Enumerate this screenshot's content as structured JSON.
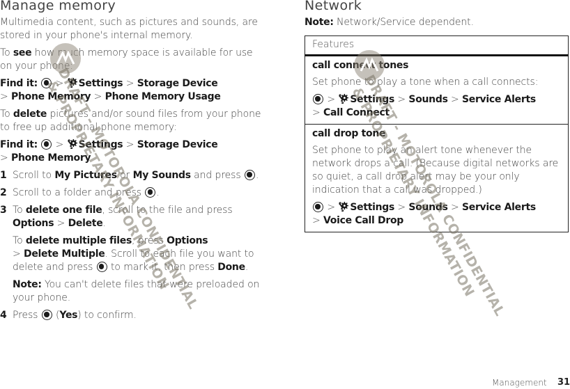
{
  "left": {
    "title": "Manage memory",
    "intro": "Multimedia content, such as pictures and sounds, are stored in your phone's internal memory.",
    "see_para": {
      "pre": "To ",
      "bold": "see",
      "post": " how much memory space is available for use on your phone:"
    },
    "find_it_1": {
      "label": "Find it:",
      "path": [
        "Settings",
        "Storage Device",
        "Phone Memory",
        "Phone Memory Usage"
      ]
    },
    "delete_para": {
      "pre": "To ",
      "bold": "delete",
      "post": " pictures and/or sound files from your phone to free up additional phone memory:"
    },
    "find_it_2": {
      "label": "Find it:",
      "path": [
        "Settings",
        "Storage Device",
        "Phone Memory"
      ]
    },
    "steps": [
      {
        "num": "1",
        "t1": "Scroll to ",
        "b1": "My Pictures",
        "t2": " or ",
        "b2": "My Sounds",
        "t3": " and press"
      },
      {
        "num": "2",
        "t1": "Scroll to a folder and press"
      },
      {
        "num": "3",
        "t1": "To ",
        "b1": "delete one file",
        "t2": ", scroll to the file and press ",
        "b2": "Options",
        "b3": "Delete",
        "sub1": {
          "t1": "To ",
          "b1": "delete multiple files",
          "t2": ", press ",
          "b2": "Options",
          "b3": "Delete Multiple",
          "t3": ". Scroll to each file you want to delete and press",
          "t4": " to mark it, then press ",
          "b4": "Done"
        },
        "note": {
          "label": "Note:",
          "text": " You can't delete files that were preloaded on your phone."
        }
      },
      {
        "num": "4",
        "t1": "Press ",
        "b1": "Yes",
        "t2": " to confirm."
      }
    ]
  },
  "right": {
    "title": "Network",
    "note": {
      "label": "Note:",
      "text": " Network/Service dependent."
    },
    "table": {
      "header": "Features",
      "rows": [
        {
          "title": "call connect tones",
          "desc": "Set phone to play a tone when a call connects:",
          "path": [
            "Settings",
            "Sounds",
            "Service Alerts",
            "Call Connect"
          ]
        },
        {
          "title": "call drop tone",
          "desc": "Set phone to play an alert tone whenever the network drops a call. (Because digital networks are so quiet, a call drop alert may be your only indication that a call was dropped.)",
          "path": [
            "Settings",
            "Sounds",
            "Service Alerts",
            "Voice Call Drop"
          ]
        }
      ]
    }
  },
  "footer": {
    "section": "Management",
    "page": "31"
  },
  "watermark": {
    "line1": "DRAFT - MOTOROLA CONFIDENTIAL",
    "line2": "& PROPRIETARY INFORMATION"
  },
  "separator": ">",
  "icons": {
    "center_key": "center-select-key-icon",
    "settings": "settings-gear-wrench-icon"
  }
}
